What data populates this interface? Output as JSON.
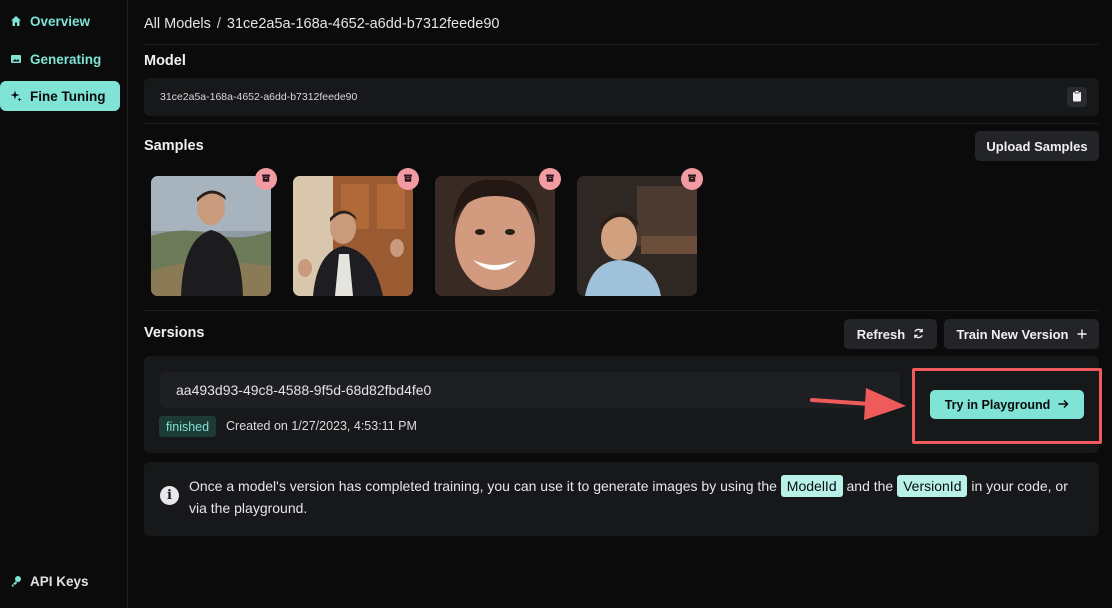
{
  "sidebar": {
    "items": [
      {
        "label": "Overview",
        "icon": "home-icon"
      },
      {
        "label": "Generating",
        "icon": "image-icon"
      },
      {
        "label": "Fine Tuning",
        "icon": "sparkle-icon"
      }
    ],
    "api_keys": {
      "label": "API Keys",
      "icon": "key-icon"
    }
  },
  "breadcrumb": {
    "root": "All Models",
    "separator": "/",
    "current": "31ce2a5a-168a-4652-a6dd-b7312feede90"
  },
  "model": {
    "title": "Model",
    "id": "31ce2a5a-168a-4652-a6dd-b7312feede90"
  },
  "samples": {
    "title": "Samples",
    "upload_label": "Upload Samples",
    "count": 4
  },
  "versions": {
    "title": "Versions",
    "refresh_label": "Refresh",
    "train_label": "Train New Version",
    "items": [
      {
        "id": "aa493d93-49c8-4588-9f5d-68d82fbd4fe0",
        "status": "finished",
        "created": "Created on 1/27/2023, 4:53:11 PM",
        "try_label": "Try in Playground"
      }
    ]
  },
  "info": {
    "text_1": "Once a model's version has completed training, you can use it to generate images by using the",
    "chip_1": "ModelId",
    "text_2": "and the",
    "chip_2": "VersionId",
    "text_3": "in your code, or via the playground."
  },
  "colors": {
    "accent": "#7fe3d6",
    "highlight": "#ef5a5a",
    "delete_badge": "#f39aa3"
  }
}
